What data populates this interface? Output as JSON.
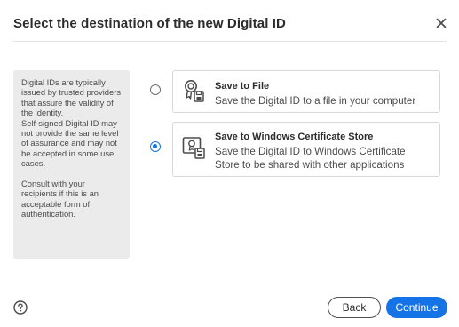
{
  "dialog": {
    "title": "Select the destination of the new Digital ID",
    "close_icon": "close-icon"
  },
  "info": {
    "paragraph1": "Digital IDs are typically issued by trusted providers that assure the validity of the identity.",
    "paragraph2": "Self-signed Digital ID may not provide the same level of assurance and may not be accepted in some use cases.",
    "paragraph3": "Consult with your recipients if this is an acceptable form of authentication."
  },
  "options": [
    {
      "title": "Save to File",
      "description": "Save the Digital ID to a file in your computer",
      "icon": "certificate-file-icon",
      "selected": false
    },
    {
      "title": "Save to Windows Certificate Store",
      "description": "Save the Digital ID to Windows Certificate Store to be shared with other applications",
      "icon": "certificate-store-icon",
      "selected": true
    }
  ],
  "footer": {
    "help_icon": "help-icon",
    "back_label": "Back",
    "continue_label": "Continue"
  },
  "colors": {
    "accent": "#1473e6",
    "panel_bg": "#ebebeb",
    "border": "#d8d8d8"
  }
}
